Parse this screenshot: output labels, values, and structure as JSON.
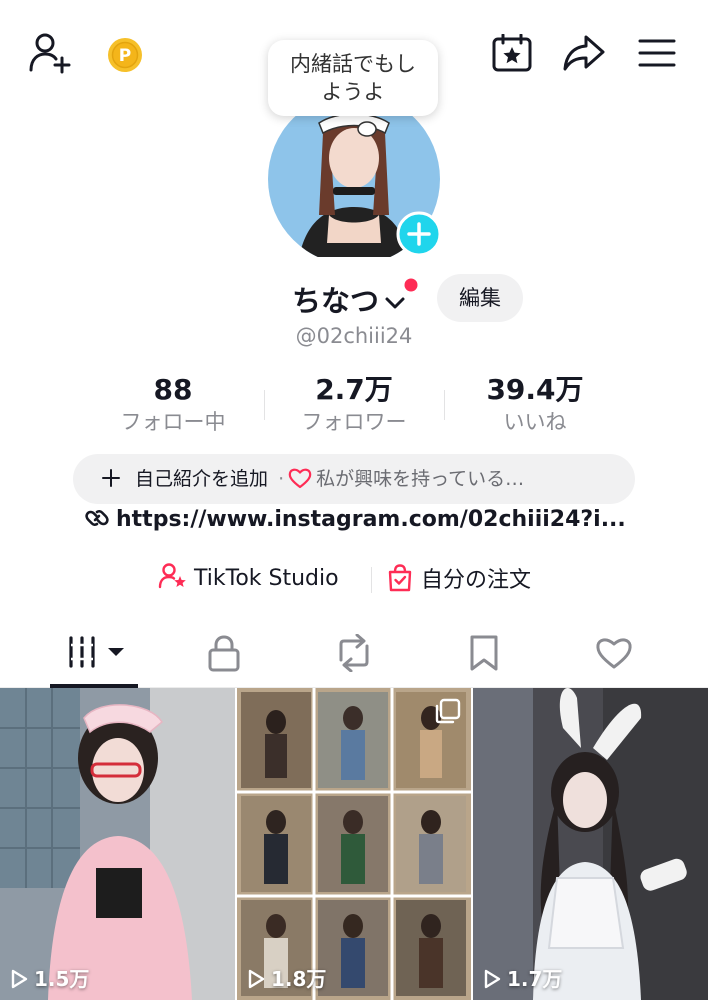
{
  "header": {
    "icons": [
      "add-friend-icon",
      "coin-icon",
      "calendar-star-icon",
      "share-icon",
      "menu-icon"
    ]
  },
  "note_bubble": {
    "line1": "内緒話でもし",
    "line2": "ようよ"
  },
  "profile": {
    "name": "ちなつ",
    "edit_label": "編集",
    "handle": "@02chiii24"
  },
  "stats": [
    {
      "value": "88",
      "label": "フォロー中"
    },
    {
      "value": "2.7万",
      "label": "フォロワー"
    },
    {
      "value": "39.4万",
      "label": "いいね"
    }
  ],
  "bio": {
    "add_label": "自己紹介を追加",
    "separator": "·",
    "interest_text": "私が興味を持っている…"
  },
  "link": {
    "url": "https://www.instagram.com/02chiii24?i..."
  },
  "shortcuts": {
    "studio": "TikTok Studio",
    "orders": "自分の注文"
  },
  "tabs": [
    "videos",
    "private",
    "reposts",
    "favorites",
    "liked"
  ],
  "videos": [
    {
      "views": "1.5万"
    },
    {
      "views": "1.8万"
    },
    {
      "views": "1.7万"
    }
  ],
  "colors": {
    "accent_cyan": "#20d5ec",
    "accent_red": "#fe2c55",
    "text": "#161823",
    "muted": "#8a8b91",
    "pill": "#f1f1f2"
  }
}
